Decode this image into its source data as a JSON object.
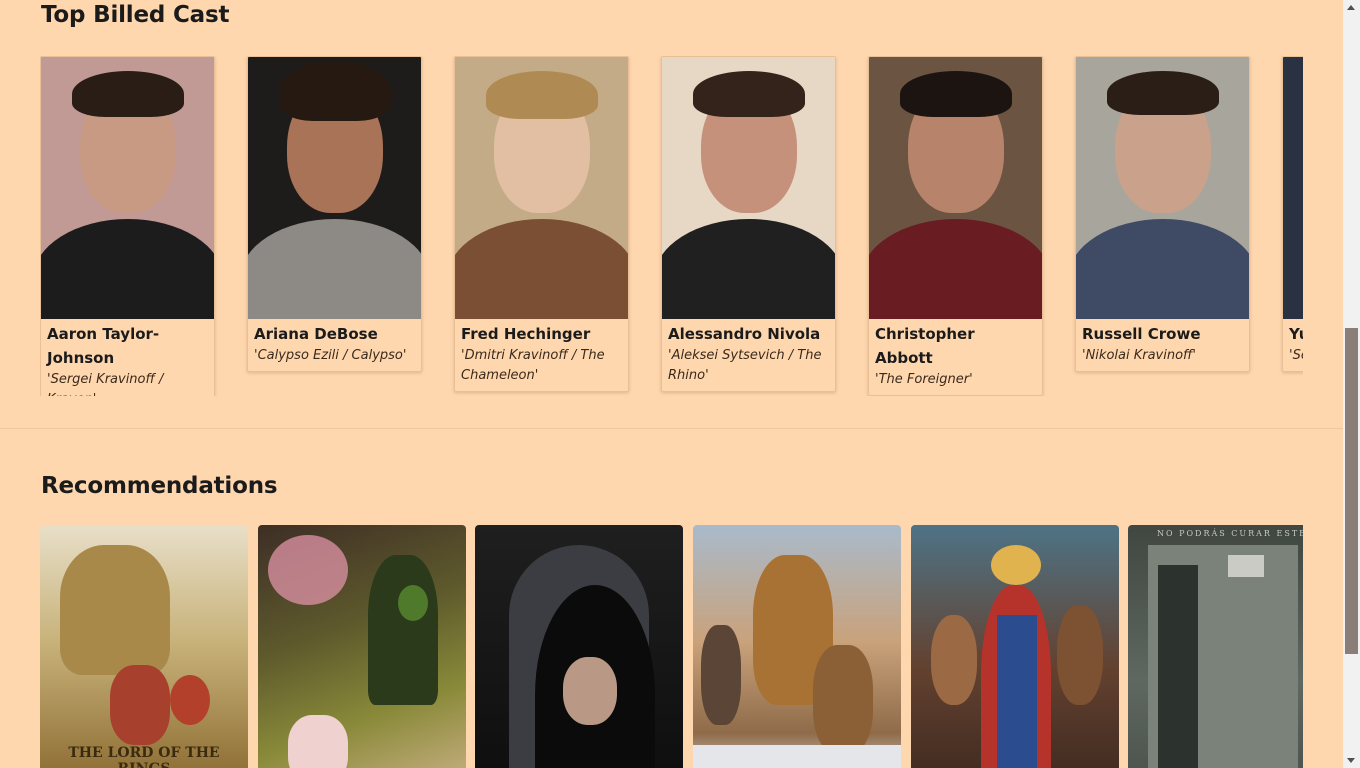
{
  "cast_section": {
    "title": "Top Billed Cast",
    "members": [
      {
        "name": "Aaron Taylor-Johnson",
        "role": "'Sergei Kravinoff / Kraven'"
      },
      {
        "name": "Ariana DeBose",
        "role": "'Calypso Ezili / Calypso'"
      },
      {
        "name": "Fred Hechinger",
        "role": "'Dmitri Kravinoff / The Chameleon'"
      },
      {
        "name": "Alessandro Nivola",
        "role": "'Aleksei Sytsevich / The Rhino'"
      },
      {
        "name": "Christopher Abbott",
        "role": "'The Foreigner'"
      },
      {
        "name": "Russell Crowe",
        "role": "'Nikolai Kravinoff'"
      },
      {
        "name": "Yu",
        "role": "'Se"
      }
    ]
  },
  "recommendations_section": {
    "title": "Recommendations",
    "posters": [
      {
        "text": "THE LORD OF THE RINGS"
      },
      {
        "text": ""
      },
      {
        "text": ""
      },
      {
        "text": ""
      },
      {
        "text": ""
      },
      {
        "text": "NO PODRÁS CURAR ESTE"
      }
    ]
  }
}
